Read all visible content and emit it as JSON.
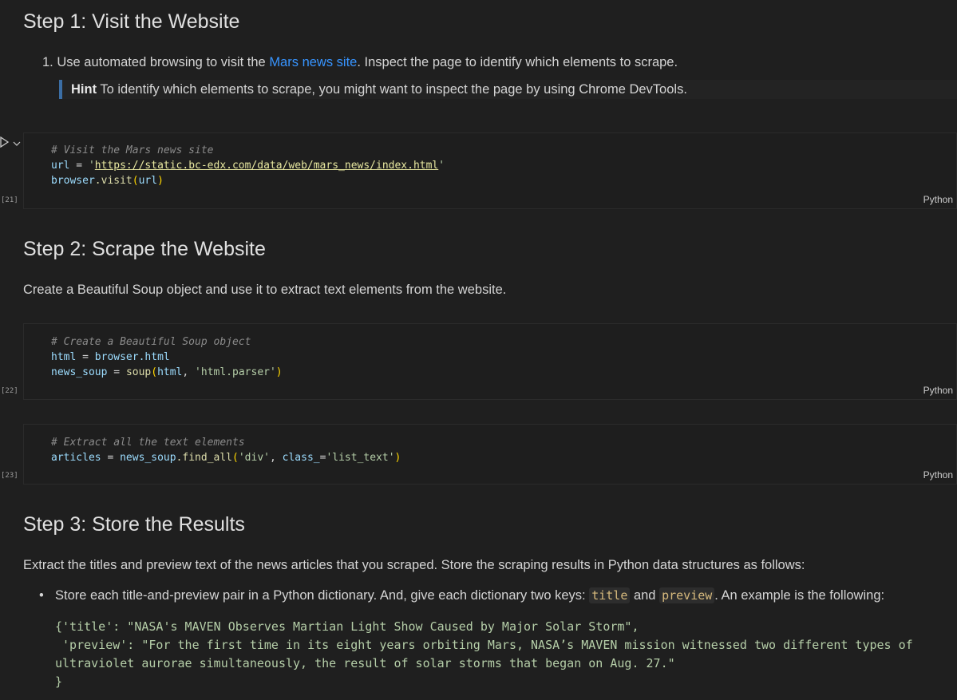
{
  "step1": {
    "heading": "Step 1: Visit the Website",
    "item_prefix": "1. Use automated browsing to visit the ",
    "link": "Mars news site",
    "item_suffix": ". Inspect the page to identify which elements to scrape.",
    "hint_label": "Hint",
    "hint_text": " To identify which elements to scrape, you might want to inspect the page by using Chrome DevTools."
  },
  "cell21": {
    "count": "[21]",
    "lang": "Python",
    "comment": "# Visit the Mars news site",
    "line2_var": "url",
    "line2_op": " = ",
    "line2_q1": "'",
    "line2_url": "https://static.bc-edx.com/data/web/mars_news/index.html",
    "line2_q2": "'",
    "line3_obj": "browser",
    "line3_fn": ".visit",
    "line3_arg": "url"
  },
  "step2": {
    "heading": "Step 2: Scrape the Website",
    "text": "Create a Beautiful Soup object and use it to extract text elements from the website."
  },
  "cell22": {
    "count": "[22]",
    "lang": "Python",
    "comment": "# Create a Beautiful Soup object",
    "l2a": "html",
    "l2b": " = ",
    "l2c": "browser.html",
    "l3a": "news_soup",
    "l3b": " = ",
    "l3c": "soup",
    "l3d": "html",
    "l3e": "'html.parser'"
  },
  "cell23": {
    "count": "[23]",
    "lang": "Python",
    "comment": "# Extract all the text elements",
    "l2a": "articles",
    "l2b": " = ",
    "l2c": "news_soup",
    "l2d": ".find_all",
    "l2e": "'div'",
    "l2f": "class_",
    "l2g": "'list_text'"
  },
  "step3": {
    "heading": "Step 3: Store the Results",
    "text": "Extract the titles and preview text of the news articles that you scraped. Store the scraping results in Python data structures as follows:",
    "bullet_prefix": "Store each title-and-preview pair in a Python dictionary. And, give each dictionary two keys: ",
    "key1": "title",
    "and": " and ",
    "key2": "preview",
    "bullet_suffix": ". An example is the following:",
    "example": "{'title': \"NASA's MAVEN Observes Martian Light Show Caused by Major Solar Storm\",\n 'preview': \"For the first time in its eight years orbiting Mars, NASA’s MAVEN mission witnessed two different types of ultraviolet aurorae simultaneously, the result of solar storms that began on Aug. 27.\"\n}"
  }
}
